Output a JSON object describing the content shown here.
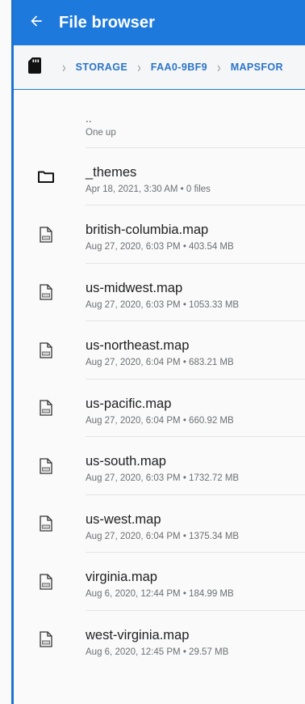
{
  "app_bar": {
    "title": "File browser",
    "back_icon": "arrow-left-icon"
  },
  "breadcrumb": {
    "root_icon": "sd-card-icon",
    "separator": "›",
    "items": [
      "STORAGE",
      "FAA0-9BF9",
      "MAPSFOR"
    ]
  },
  "files": [
    {
      "name": "..",
      "meta": "One up",
      "icon": "none"
    },
    {
      "name": "_themes",
      "meta": "Apr 18, 2021, 3:30 AM • 0 files",
      "icon": "folder-icon"
    },
    {
      "name": "british-columbia.map",
      "meta": "Aug 27, 2020, 6:03 PM • 403.54 MB",
      "icon": "map-file-icon"
    },
    {
      "name": "us-midwest.map",
      "meta": "Aug 27, 2020, 6:03 PM • 1053.33 MB",
      "icon": "map-file-icon"
    },
    {
      "name": "us-northeast.map",
      "meta": "Aug 27, 2020, 6:04 PM • 683.21 MB",
      "icon": "map-file-icon"
    },
    {
      "name": "us-pacific.map",
      "meta": "Aug 27, 2020, 6:04 PM • 660.92 MB",
      "icon": "map-file-icon"
    },
    {
      "name": "us-south.map",
      "meta": "Aug 27, 2020, 6:03 PM • 1732.72 MB",
      "icon": "map-file-icon"
    },
    {
      "name": "us-west.map",
      "meta": "Aug 27, 2020, 6:04 PM • 1375.34 MB",
      "icon": "map-file-icon"
    },
    {
      "name": "virginia.map",
      "meta": "Aug 6, 2020, 12:44 PM • 184.99 MB",
      "icon": "map-file-icon"
    },
    {
      "name": "west-virginia.map",
      "meta": "Aug 6, 2020, 12:45 PM • 29.57 MB",
      "icon": "map-file-icon"
    }
  ],
  "colors": {
    "app_bar": "#1e79dc",
    "breadcrumb_text": "#2a74c8",
    "background": "#fafafa"
  }
}
